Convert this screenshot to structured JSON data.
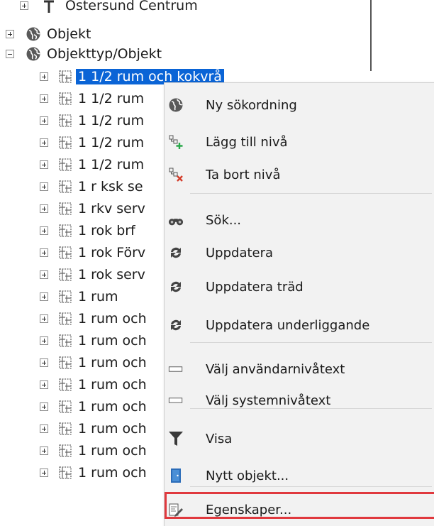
{
  "tree": {
    "top_item": "Östersund Centrum",
    "objekt": "Objekt",
    "objekttyp": "Objekttyp/Objekt",
    "children": [
      "1 1/2 rum och kokvrå",
      "1 1/2 rum",
      "1 1/2 rum",
      "1 1/2 rum",
      "1 1/2 rum",
      "1 r ksk se",
      "1 rkv serv",
      "1 rok brf",
      "1 rok Förv",
      "1 rok serv",
      "1 rum",
      "1 rum och",
      "1 rum och",
      "1 rum och",
      "1 rum och",
      "1 rum och",
      "1 rum och",
      "1 rum och",
      "1 rum och"
    ]
  },
  "context_menu": {
    "items": [
      {
        "label": "Ny sökordning",
        "icon": "globe-icon"
      },
      {
        "label": "Lägg till nivå",
        "icon": "add-level-icon"
      },
      {
        "label": "Ta bort nivå",
        "icon": "remove-level-icon"
      },
      {
        "label": "Sök...",
        "icon": "binoculars-icon"
      },
      {
        "label": "Uppdatera",
        "icon": "refresh-icon"
      },
      {
        "label": "Uppdatera träd",
        "icon": "refresh-icon"
      },
      {
        "label": "Uppdatera underliggande",
        "icon": "refresh-icon"
      },
      {
        "label": "Välj användarnivåtext",
        "icon": "textbox-icon"
      },
      {
        "label": "Välj systemnivåtext",
        "icon": "textbox-icon"
      },
      {
        "label": "Visa",
        "icon": "filter-funnel-icon"
      },
      {
        "label": "Nytt objekt...",
        "icon": "door-icon"
      },
      {
        "label": "Egenskaper...",
        "icon": "properties-icon"
      }
    ]
  },
  "colors": {
    "selection": "#0a64d6",
    "highlight_box": "#e0393e",
    "menu_bg": "#f2f2f2"
  }
}
